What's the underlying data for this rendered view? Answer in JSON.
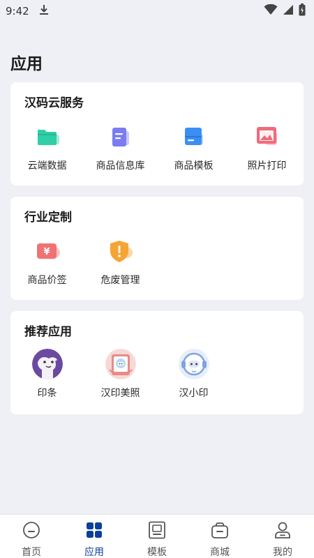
{
  "status_bar": {
    "time": "9:42"
  },
  "page": {
    "title": "应用"
  },
  "sections": [
    {
      "title": "汉码云服务",
      "items": [
        {
          "label": "云端数据",
          "icon": "folder-icon"
        },
        {
          "label": "商品信息库",
          "icon": "document-icon"
        },
        {
          "label": "商品模板",
          "icon": "template-icon"
        },
        {
          "label": "照片打印",
          "icon": "photo-icon"
        }
      ]
    },
    {
      "title": "行业定制",
      "items": [
        {
          "label": "商品价签",
          "icon": "price-tag-icon"
        },
        {
          "label": "危废管理",
          "icon": "warning-shield-icon"
        }
      ]
    },
    {
      "title": "推荐应用",
      "items": [
        {
          "label": "印条",
          "icon": "yintiao-app-icon"
        },
        {
          "label": "汉印美照",
          "icon": "meizhao-app-icon"
        },
        {
          "label": "汉小印",
          "icon": "hanxiaoyin-app-icon"
        }
      ]
    }
  ],
  "bottom_nav": [
    {
      "label": "首页",
      "icon": "home-icon",
      "active": false
    },
    {
      "label": "应用",
      "icon": "apps-icon",
      "active": true
    },
    {
      "label": "模板",
      "icon": "template-nav-icon",
      "active": false
    },
    {
      "label": "商城",
      "icon": "shop-icon",
      "active": false
    },
    {
      "label": "我的",
      "icon": "profile-icon",
      "active": false
    }
  ],
  "colors": {
    "background": "#eff0f5",
    "active_nav": "#0c3f9d",
    "folder": "#2fcfa8",
    "document": "#7b7cf2",
    "template": "#3a8ff4",
    "photo": "#f06a7a",
    "price_tag": "#f07275",
    "warning": "#f5a535"
  }
}
